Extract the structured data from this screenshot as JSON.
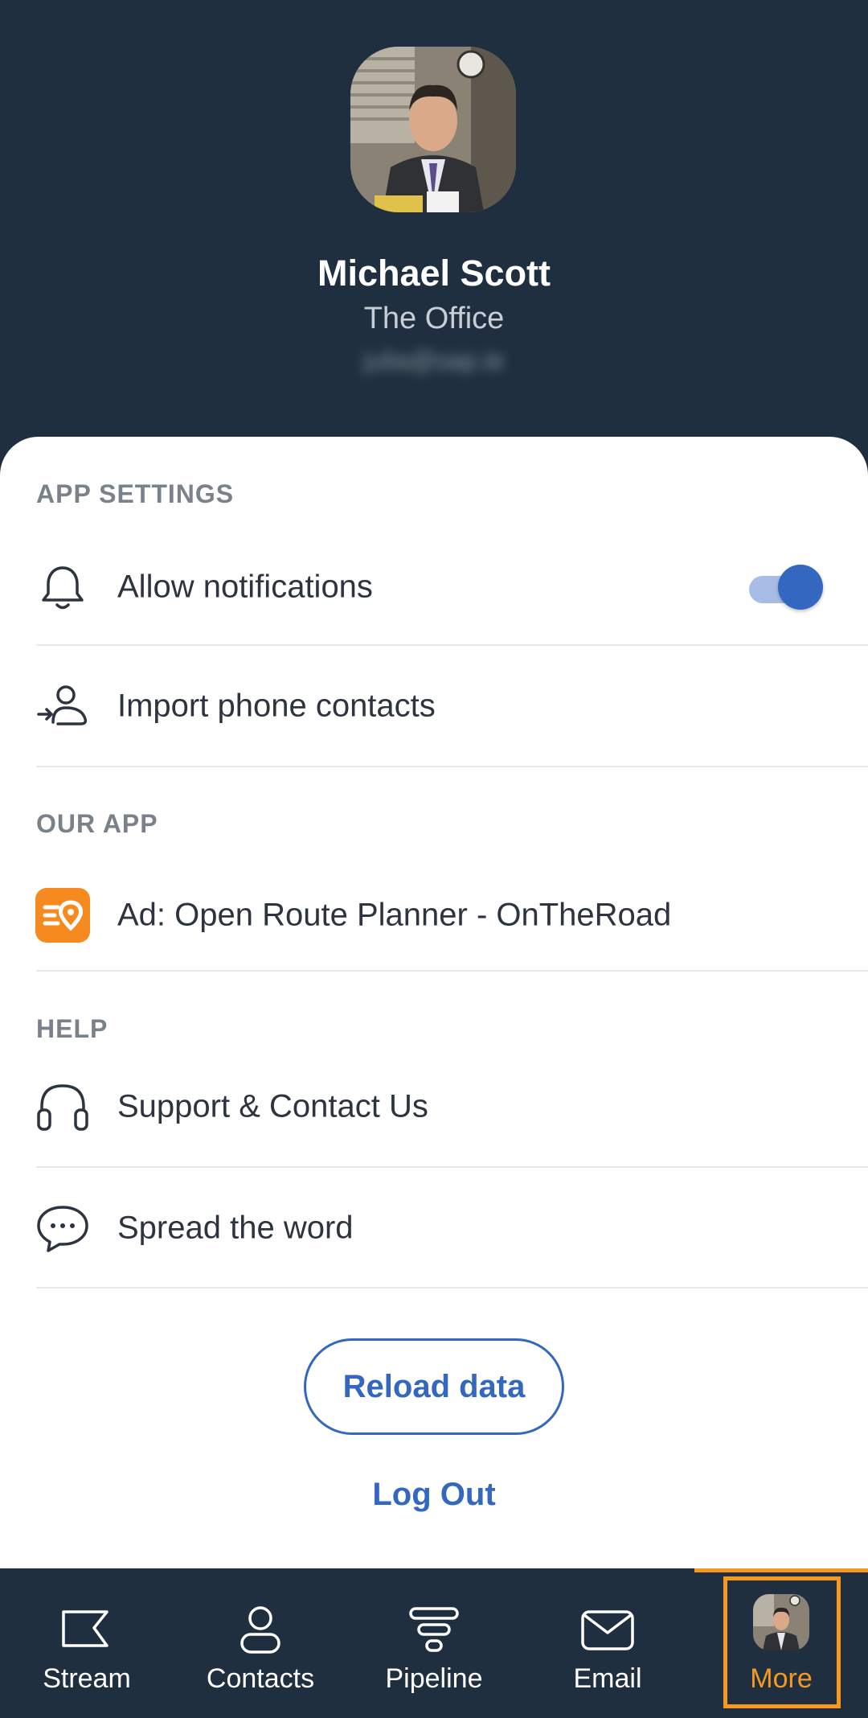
{
  "profile": {
    "name": "Michael Scott",
    "company": "The Office",
    "email": "julia@sap.ie"
  },
  "sections": {
    "app_settings": "APP SETTINGS",
    "our_app": "OUR APP",
    "help": "HELP"
  },
  "rows": {
    "notifications": {
      "label": "Allow notifications",
      "icon": "bell-icon",
      "toggle_on": true
    },
    "import_contacts": {
      "label": "Import phone contacts",
      "icon": "import-contact-icon"
    },
    "ad": {
      "label": "Ad: Open Route Planner - OnTheRoad",
      "icon": "route-planner-logo"
    },
    "support": {
      "label": "Support & Contact Us",
      "icon": "headphones-icon"
    },
    "spread": {
      "label": "Spread the word",
      "icon": "chat-bubble-icon"
    }
  },
  "actions": {
    "reload": "Reload data",
    "logout": "Log Out"
  },
  "nav": {
    "items": [
      {
        "label": "Stream",
        "icon": "stream-flag-icon"
      },
      {
        "label": "Contacts",
        "icon": "person-icon"
      },
      {
        "label": "Pipeline",
        "icon": "funnel-icon"
      },
      {
        "label": "Email",
        "icon": "envelope-icon"
      },
      {
        "label": "More",
        "icon": "avatar"
      }
    ],
    "active": "More"
  },
  "colors": {
    "header_bg": "#1f2f3f",
    "accent_blue": "#3467c0",
    "accent_orange": "#f59a1f",
    "text_dark": "#2d3440",
    "section_gray": "#7a818a"
  }
}
